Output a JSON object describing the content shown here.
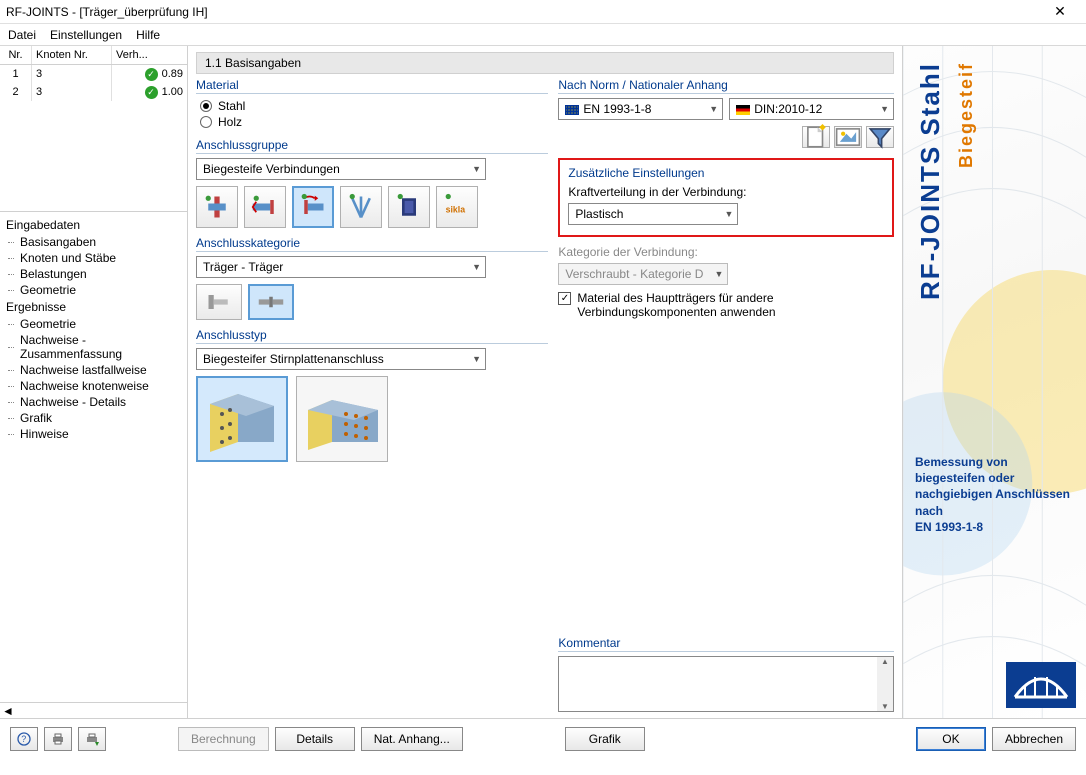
{
  "window": {
    "title": "RF-JOINTS - [Träger_überprüfung IH]",
    "close": "✕"
  },
  "menu": {
    "file": "Datei",
    "settings": "Einstellungen",
    "help": "Hilfe"
  },
  "table": {
    "h1": "Nr.",
    "h2": "Knoten Nr.",
    "h3": "Verh...",
    "rows": [
      {
        "nr": "1",
        "knoten": "3",
        "verh": "0.89"
      },
      {
        "nr": "2",
        "knoten": "3",
        "verh": "1.00"
      }
    ]
  },
  "tree": {
    "input": "Eingabedaten",
    "items1": [
      "Basisangaben",
      "Knoten und Stäbe",
      "Belastungen",
      "Geometrie"
    ],
    "results": "Ergebnisse",
    "items2": [
      "Geometrie",
      "Nachweise - Zusammenfassung",
      "Nachweise lastfallweise",
      "Nachweise knotenweise",
      "Nachweise - Details",
      "Grafik",
      "Hinweise"
    ]
  },
  "section_title": "1.1 Basisangaben",
  "material": {
    "title": "Material",
    "steel": "Stahl",
    "wood": "Holz"
  },
  "group": {
    "title": "Anschlussgruppe",
    "value": "Biegesteife Verbindungen",
    "icons": [
      "joint-rigid",
      "joint-beam",
      "joint-moment",
      "joint-truss",
      "joint-hollow",
      "joint-sikla"
    ]
  },
  "category": {
    "title": "Anschlusskategorie",
    "value": "Träger - Träger",
    "icons": [
      "cat-column",
      "cat-beam"
    ]
  },
  "conntype": {
    "title": "Anschlusstyp",
    "value": "Biegesteifer Stirnplattenanschluss",
    "icons": [
      "type-endplate-flush",
      "type-endplate-extended"
    ]
  },
  "norm": {
    "title": "Nach Norm / Nationaler Anhang",
    "code": "EN 1993-1-8",
    "annex": "DIN:2010-12",
    "tools": [
      "new-icon",
      "picture-icon",
      "filter-icon"
    ]
  },
  "extra": {
    "title": "Zusätzliche Einstellungen",
    "force_label": "Kraftverteilung in der Verbindung:",
    "force_value": "Plastisch",
    "cat_label": "Kategorie der Verbindung:",
    "cat_value": "Verschraubt - Kategorie D",
    "check_label": "Material des Hauptträgers für andere Verbindungskomponenten anwenden"
  },
  "comment_title": "Kommentar",
  "brand": {
    "main": "RF-JOINTS Stahl",
    "sub": "Biegesteif",
    "desc": "Bemessung von biegesteifen oder nachgiebigen Anschlüssen nach\nEN 1993-1-8"
  },
  "bottom": {
    "help": "?",
    "print": "print",
    "export": "export",
    "calc": "Berechnung",
    "details": "Details",
    "annex": "Nat. Anhang...",
    "grafik": "Grafik",
    "ok": "OK",
    "cancel": "Abbrechen"
  }
}
